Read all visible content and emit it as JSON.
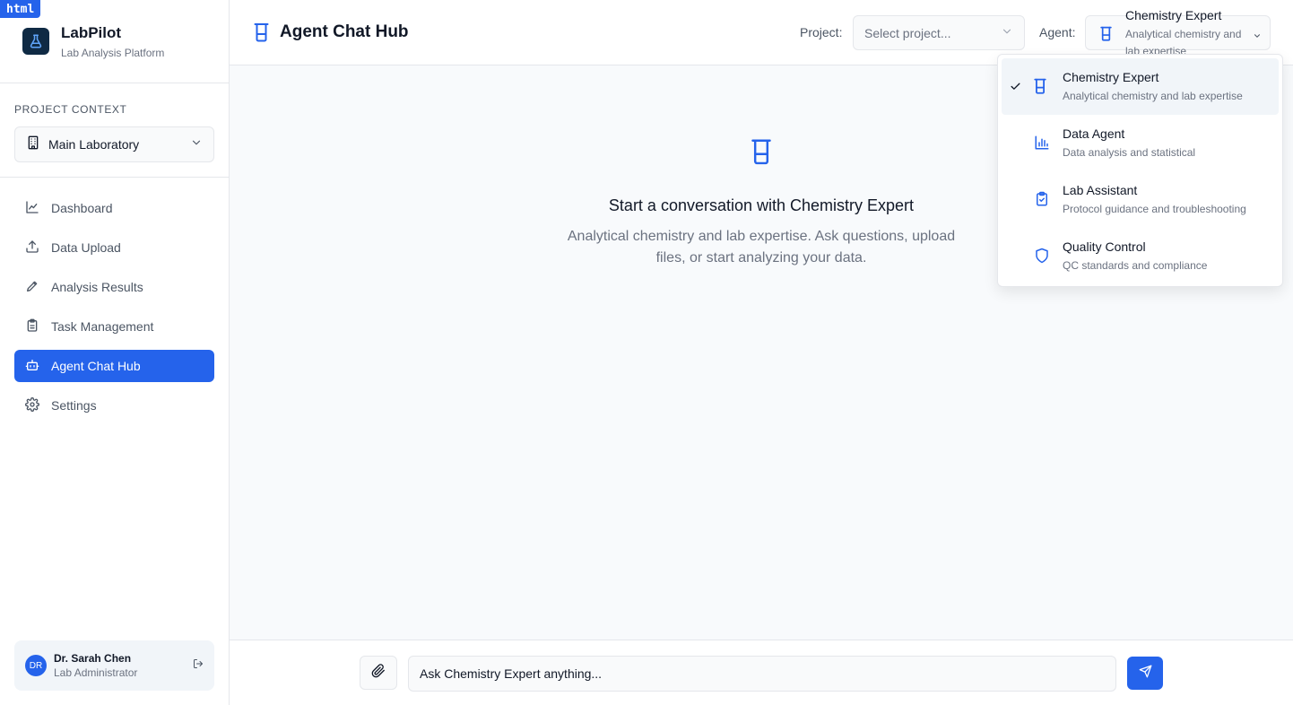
{
  "dev_badge": "html",
  "brand": {
    "name": "LabPilot",
    "subtitle": "Lab Analysis Platform"
  },
  "project_context": {
    "label": "PROJECT CONTEXT",
    "selected": "Main Laboratory"
  },
  "nav": {
    "items": [
      {
        "label": "Dashboard",
        "icon": "line-chart-icon",
        "active": false
      },
      {
        "label": "Data Upload",
        "icon": "upload-icon",
        "active": false
      },
      {
        "label": "Analysis Results",
        "icon": "pen-icon",
        "active": false
      },
      {
        "label": "Task Management",
        "icon": "clipboard-icon",
        "active": false
      },
      {
        "label": "Agent Chat Hub",
        "icon": "bot-icon",
        "active": true
      },
      {
        "label": "Settings",
        "icon": "gear-icon",
        "active": false
      }
    ]
  },
  "user": {
    "initials": "DR",
    "name": "Dr. Sarah Chen",
    "role": "Lab Administrator"
  },
  "header": {
    "title": "Agent Chat Hub",
    "project_label": "Project:",
    "project_placeholder": "Select project...",
    "agent_label": "Agent:",
    "agent_name": "Chemistry Expert",
    "agent_desc": "Analytical chemistry and lab expertise"
  },
  "empty_state": {
    "title": "Start a conversation with Chemistry Expert",
    "description": "Analytical chemistry and lab expertise. Ask questions, upload files, or start analyzing your data."
  },
  "agents": [
    {
      "name": "Chemistry Expert",
      "desc": "Analytical chemistry and lab expertise",
      "icon": "beaker-icon",
      "selected": true
    },
    {
      "name": "Data Agent",
      "desc": "Data analysis and statistical",
      "icon": "bar-chart-icon",
      "selected": false
    },
    {
      "name": "Lab Assistant",
      "desc": "Protocol guidance and troubleshooting",
      "icon": "clipboard-check-icon",
      "selected": false
    },
    {
      "name": "Quality Control",
      "desc": "QC standards and compliance",
      "icon": "shield-icon",
      "selected": false
    }
  ],
  "composer": {
    "placeholder": "Ask Chemistry Expert anything..."
  },
  "colors": {
    "accent": "#2563eb",
    "logo_bg": "#0f2a44"
  }
}
